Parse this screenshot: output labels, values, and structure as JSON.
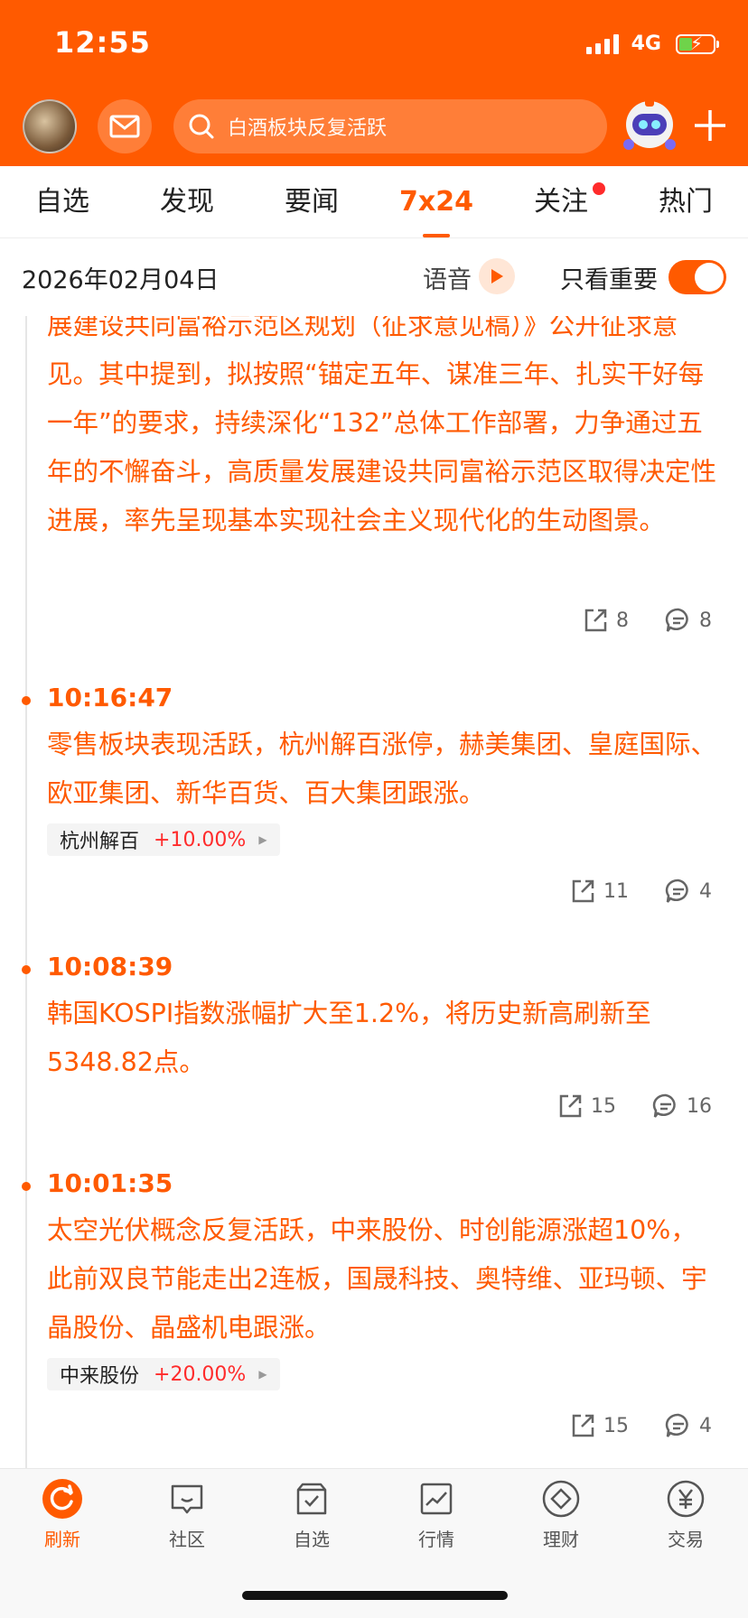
{
  "status_bar": {
    "time": "12:55",
    "network": "4G"
  },
  "header": {
    "search_placeholder": "白酒板块反复活跃"
  },
  "tabs": [
    {
      "label": "自选"
    },
    {
      "label": "发现"
    },
    {
      "label": "要闻"
    },
    {
      "label": "7x24",
      "active": true
    },
    {
      "label": "关注",
      "has_dot": true
    },
    {
      "label": "热门"
    }
  ],
  "date_bar": {
    "date": "2026年02月04日",
    "voice_label": "语音",
    "only_important_label": "只看重要",
    "only_important_on": true
  },
  "feed": [
    {
      "time": "",
      "content": "展建设共同富裕示范区规划（征求意见稿）》公开征求意见。其中提到，拟按照“锚定五年、谋准三年、扎实干好每一年”的要求，持续深化“132”总体工作部署，力争通过五年的不懈奋斗，高质量发展建设共同富裕示范区取得决定性进展，率先呈现基本实现社会主义现代化的生动图景。",
      "share_count": "8",
      "comment_count": "8"
    },
    {
      "time": "10:16:47",
      "content": "零售板块表现活跃，杭州解百涨停，赫美集团、皇庭国际、欧亚集团、新华百货、百大集团跟涨。",
      "stock": {
        "name": "杭州解百",
        "change": "+10.00%"
      },
      "share_count": "11",
      "comment_count": "4"
    },
    {
      "time": "10:08:39",
      "content": "韩国KOSPI指数涨幅扩大至1.2%，将历史新高刷新至5348.82点。",
      "share_count": "15",
      "comment_count": "16"
    },
    {
      "time": "10:01:35",
      "content": "太空光伏概念反复活跃，中来股份、时创能源涨超10%，此前双良节能走出2连板，国晟科技、奥特维、亚玛顿、宇晶股份、晶盛机电跟涨。",
      "stock": {
        "name": "中来股份",
        "change": "+20.00%"
      },
      "share_count": "15",
      "comment_count": "4"
    }
  ],
  "bottom_nav": [
    {
      "label": "刷新",
      "icon": "refresh-icon",
      "active": true
    },
    {
      "label": "社区",
      "icon": "community-icon"
    },
    {
      "label": "自选",
      "icon": "watchlist-icon"
    },
    {
      "label": "行情",
      "icon": "market-chart-icon"
    },
    {
      "label": "理财",
      "icon": "wealth-icon"
    },
    {
      "label": "交易",
      "icon": "yen-trade-icon"
    }
  ],
  "colors": {
    "brand": "#ff5a00",
    "rise": "#ff2b2b"
  }
}
